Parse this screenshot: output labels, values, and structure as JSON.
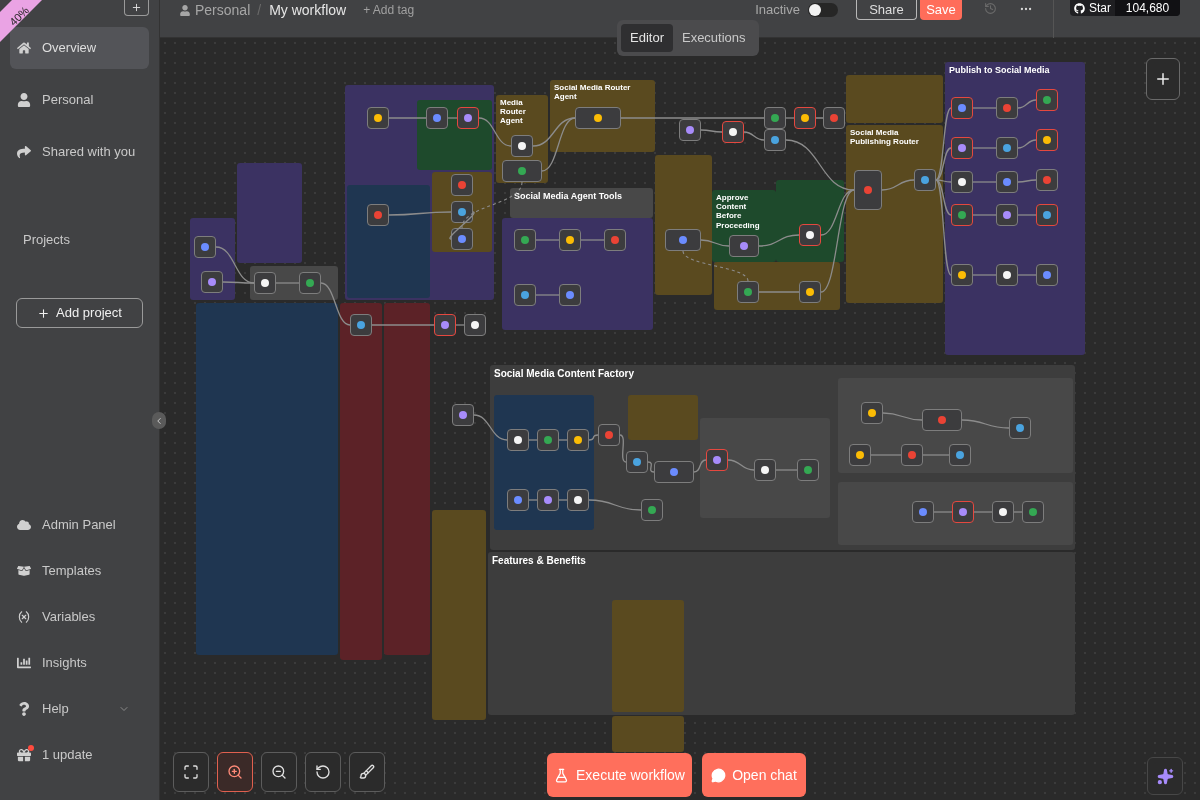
{
  "corner_ribbon": {
    "label": "40%"
  },
  "sidebar": {
    "top_items": [
      {
        "label": "Overview",
        "selected": true
      },
      {
        "label": "Personal",
        "selected": false
      },
      {
        "label": "Shared with you",
        "selected": false
      }
    ],
    "projects_heading": "Projects",
    "add_project_button": "Add project",
    "bottom_items": [
      {
        "label": "Admin Panel",
        "expandable": false,
        "notification": false
      },
      {
        "label": "Templates",
        "expandable": false,
        "notification": false
      },
      {
        "label": "Variables",
        "expandable": false,
        "notification": false
      },
      {
        "label": "Insights",
        "expandable": false,
        "notification": false
      },
      {
        "label": "Help",
        "expandable": true,
        "notification": false
      },
      {
        "label": "1 update",
        "expandable": false,
        "notification": true
      }
    ]
  },
  "header": {
    "project": "Personal",
    "separator": "/",
    "workflow_name": "My workflow",
    "add_tag": "+ Add tag",
    "status_label": "Inactive",
    "active": false,
    "share_button": "Share",
    "save_button": "Save",
    "github_button": {
      "label": "Star",
      "count": "104,680"
    }
  },
  "view_tabs": [
    {
      "label": "Editor",
      "selected": true
    },
    {
      "label": "Executions",
      "selected": false
    }
  ],
  "canvas": {
    "sticky_notes": [
      {
        "color": "#3b3262"
      },
      {
        "color": "#3b3262"
      },
      {
        "color": "#484848"
      },
      {
        "color": "#1f3651"
      },
      {
        "color": "#5c2227"
      },
      {
        "color": "#5c2227"
      },
      {
        "color": "#3b3262"
      },
      {
        "color": "#1f3651"
      },
      {
        "color": "#1e4a2c"
      },
      {
        "color": "#5a4a1f"
      },
      {
        "title": "Media Router Agent",
        "color": "#5a4a1f"
      },
      {
        "title": "Social Media Router Agent",
        "color": "#5a4a1f"
      },
      {
        "color": "#3b3262"
      },
      {
        "title": "Social Media Agent Tools",
        "color": "#484848"
      },
      {
        "color": "#5a4a1f"
      },
      {
        "title": "Approve Content Before Proceeding",
        "color": "#1e4a2c"
      },
      {
        "color": "#1e4a2c"
      },
      {
        "color": "#5a4a1f"
      },
      {
        "title": "Publish to Social Media",
        "color": "#3b3262"
      },
      {
        "color": "#5a4a1f"
      },
      {
        "title": "Social Media Publishing Router",
        "color": "#5a4a1f"
      },
      {
        "title": "Social Media Content Factory",
        "color": "#3d3d3d"
      },
      {
        "color": "#1f3651"
      },
      {
        "color": "#5a4a1f"
      },
      {
        "color": "#484848"
      },
      {
        "color": "#484848"
      },
      {
        "color": "#484848"
      },
      {
        "title": "Features & Benefits",
        "color": "#3d3d3d"
      },
      {
        "color": "#5a4a1f"
      },
      {
        "color": "#5a4a1f"
      },
      {
        "color": "#5a4a1f"
      }
    ],
    "nodes": [
      {
        "warning": false
      },
      {
        "warning": false
      },
      {
        "warning": false
      },
      {
        "warning": false
      },
      {
        "warning": false
      },
      {
        "warning": false
      },
      {
        "warning": false
      },
      {
        "warning": false
      },
      {
        "warning": true
      },
      {
        "warning": false
      },
      {
        "warning": false
      },
      {
        "warning": false
      },
      {
        "warning": false
      },
      {
        "warning": false
      },
      {
        "warning": false
      },
      {
        "warning": true
      },
      {
        "warning": false
      },
      {
        "warning": false
      },
      {
        "warning": false
      },
      {
        "warning": false
      },
      {
        "warning": false
      },
      {
        "warning": false
      },
      {
        "warning": false
      },
      {
        "warning": true
      },
      {
        "warning": false
      },
      {
        "warning": true
      },
      {
        "warning": false
      },
      {
        "warning": false
      },
      {
        "warning": false
      },
      {
        "warning": false
      },
      {
        "warning": true
      },
      {
        "warning": false
      },
      {
        "warning": false
      },
      {
        "warning": false
      },
      {
        "warning": false
      },
      {
        "warning": true
      },
      {
        "warning": true
      },
      {
        "warning": false
      },
      {
        "warning": true
      },
      {
        "warning": false
      },
      {
        "warning": false
      },
      {
        "warning": false
      },
      {
        "warning": false
      },
      {
        "warning": false
      },
      {
        "warning": false
      },
      {
        "warning": true
      },
      {
        "warning": true
      },
      {
        "warning": false
      },
      {
        "warning": true
      },
      {
        "warning": false
      },
      {
        "warning": false
      },
      {
        "warning": false
      },
      {
        "warning": false
      },
      {
        "warning": false
      },
      {
        "warning": false
      },
      {
        "warning": false
      },
      {
        "warning": false
      },
      {
        "warning": true
      },
      {
        "warning": false
      },
      {
        "warning": false
      },
      {
        "warning": false
      },
      {
        "warning": false
      },
      {
        "warning": false
      },
      {
        "warning": false
      },
      {
        "warning": false
      },
      {
        "warning": false
      },
      {
        "warning": false
      },
      {
        "warning": false
      },
      {
        "warning": false
      },
      {
        "warning": false
      },
      {
        "warning": false
      },
      {
        "warning": true
      },
      {
        "warning": false
      },
      {
        "warning": false
      }
    ]
  },
  "canvas_controls": [
    {
      "kind": "fit_view",
      "selected": false
    },
    {
      "kind": "zoom_in",
      "selected": true
    },
    {
      "kind": "zoom_out",
      "selected": false
    },
    {
      "kind": "reset",
      "selected": false
    },
    {
      "kind": "tidy",
      "selected": false
    }
  ],
  "execute_button": "Execute workflow",
  "chat_button": "Open chat"
}
